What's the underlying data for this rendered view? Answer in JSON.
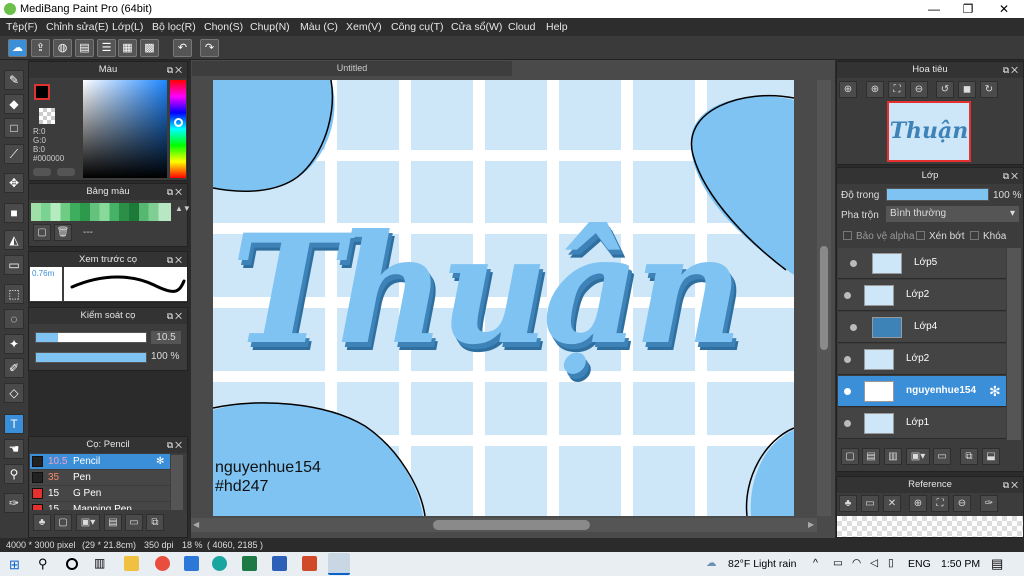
{
  "app": {
    "title": "MediBang Paint Pro (64bit)"
  },
  "menu": [
    "Tệp(F)",
    "Chỉnh sửa(E)",
    "Lớp(L)",
    "Bộ lọc(R)",
    "Chọn(S)",
    "Chụp(N)",
    "Màu (C)",
    "Xem(V)",
    "Công cụ(T)",
    "Cửa sổ(W)",
    "Cloud",
    "Help"
  ],
  "document": {
    "tab_title": "Untitled"
  },
  "color_panel": {
    "title": "Màu",
    "r": "R:0",
    "g": "G:0",
    "b": "B:0",
    "hex": "#000000",
    "foreground": "#000000",
    "background": "#7ec3f2"
  },
  "swatch_panel": {
    "title": "Bảng màu",
    "label": "---"
  },
  "brush_preview": {
    "title": "Xem trước cọ",
    "size": "0.76m"
  },
  "brush_control": {
    "title": "Kiểm soát cọ",
    "size": "10.5",
    "opacity": "100 %"
  },
  "brush_panel": {
    "title": "Cọ: Pencil",
    "items": [
      {
        "size": "10.5",
        "name": "Pencil",
        "color": "#222222"
      },
      {
        "size": "35",
        "name": "Pen",
        "color": "#222222"
      },
      {
        "size": "15",
        "name": "G Pen",
        "color": "#e53030"
      },
      {
        "size": "15",
        "name": "Mapping Pen",
        "color": "#e53030"
      }
    ]
  },
  "navigator": {
    "title": "Hoa tiêu"
  },
  "layer_panel": {
    "title": "Lớp",
    "opacity_label": "Độ trong",
    "opacity_value": "100 %",
    "blend_label": "Pha trộn",
    "blend_value": "Bình thường",
    "protect_alpha": "Bảo vệ alpha",
    "clipping": "Xén bớt",
    "lock": "Khóa",
    "layers": [
      "Lớp5",
      "Lớp2",
      "Lớp4",
      "Lớp2",
      "nguyenhue154",
      "Lớp1"
    ]
  },
  "reference": {
    "title": "Reference"
  },
  "canvas": {
    "word": "Thuận",
    "caption1": "nguyenhue154",
    "caption2": "#hd247"
  },
  "status": {
    "size": "4000 * 3000 pixel",
    "cm": "(29 * 21.8cm)",
    "dpi": "350 dpi",
    "zoom": "18 %",
    "coords": "( 4060, 2185 )"
  },
  "taskbar": {
    "weather": "82°F  Light rain",
    "lang": "ENG",
    "time": "1:50 PM"
  },
  "colors": {
    "accent": "#3b8fd8",
    "canvas_bg": "#cde6f8",
    "blob": "#7ec3f2",
    "grid": "#ffffff"
  }
}
